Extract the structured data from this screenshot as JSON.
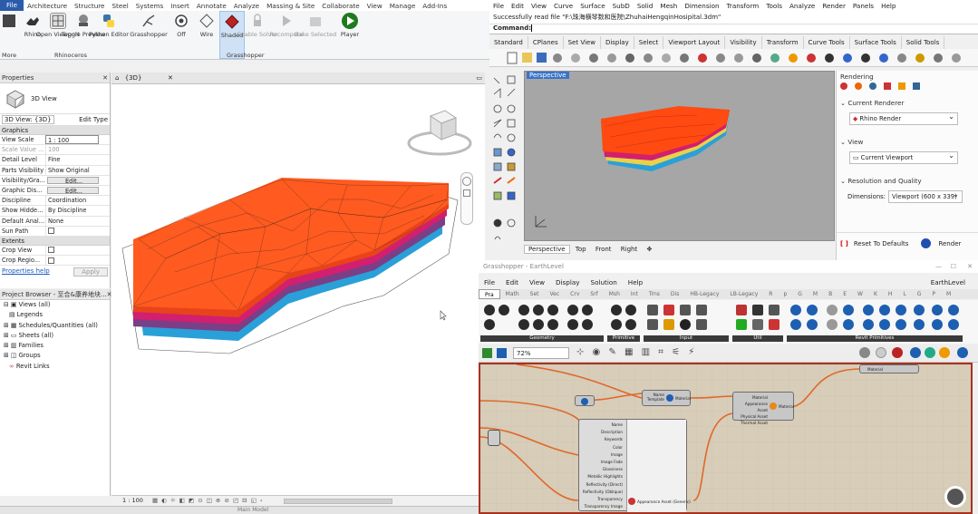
{
  "revit": {
    "menu": [
      "File",
      "Architecture",
      "Structure",
      "Steel",
      "Systems",
      "Insert",
      "Annotate",
      "Analyze",
      "Massing & Site",
      "Collaborate",
      "View",
      "Manage",
      "Add-Ins"
    ],
    "ribbon_buttons": [
      "Rhino",
      "Open Viewport",
      "Toggle Preview",
      "Python Editor",
      "Grasshopper",
      "Off",
      "Wire",
      "Shaded",
      "Enable Solver",
      "Recompute",
      "Bake Selected",
      "Player"
    ],
    "ribbon_groups": {
      "more": "More",
      "rhinoceros": "Rhinoceros",
      "grasshopper": "Grasshopper"
    },
    "properties": {
      "title": "Properties",
      "type_label": "3D View",
      "view_selector": "3D View: {3D}",
      "edit_type": "Edit Type",
      "section_graphics": "Graphics",
      "rows": [
        {
          "k": "View Scale",
          "v": "1 : 100"
        },
        {
          "k": "Scale Value ...",
          "v": "100"
        },
        {
          "k": "Detail Level",
          "v": "Fine"
        },
        {
          "k": "Parts Visibility",
          "v": "Show Original"
        },
        {
          "k": "Visibility/Gra...",
          "v": "Edit..."
        },
        {
          "k": "Graphic Dis...",
          "v": "Edit..."
        },
        {
          "k": "Discipline",
          "v": "Coordination"
        },
        {
          "k": "Show Hidde...",
          "v": "By Discipline"
        },
        {
          "k": "Default Anal...",
          "v": "None"
        },
        {
          "k": "Sun Path",
          "v": ""
        }
      ],
      "section_extents": "Extents",
      "rows2": [
        {
          "k": "Crop View",
          "v": ""
        },
        {
          "k": "Crop Regio...",
          "v": ""
        }
      ],
      "help": "Properties help",
      "apply": "Apply"
    },
    "browser": {
      "title": "Project Browser - 至合&康养地块...",
      "items": [
        "Views (all)",
        "Legends",
        "Schedules/Quantities (all)",
        "Sheets (all)",
        "Families",
        "Groups",
        "Revit Links"
      ]
    },
    "view_tab": "{3D}",
    "view_scale": "1 : 100",
    "bottom_status": "Main Model"
  },
  "rhino": {
    "menu": [
      "File",
      "Edit",
      "View",
      "Curve",
      "Surface",
      "SubD",
      "Solid",
      "Mesh",
      "Dimension",
      "Transform",
      "Tools",
      "Analyze",
      "Render",
      "Panels",
      "Help"
    ],
    "cmd_history": "Successfully read file \"F:\\珠海横琴数和医院\\ZhuhaiHengqinHosipital.3dm\"",
    "cmd_label": "Command:",
    "tabs": [
      "Standard",
      "CPlanes",
      "Set View",
      "Display",
      "Select",
      "Viewport Layout",
      "Visibility",
      "Transform",
      "Curve Tools",
      "Surface Tools",
      "Solid Tools"
    ],
    "viewport_label": "Perspective",
    "viewport_tabs": [
      "Perspective",
      "Top",
      "Front",
      "Right"
    ],
    "rendering": {
      "title": "Rendering",
      "current_renderer": "Current Renderer",
      "renderer": "Rhino Render",
      "view": "View",
      "view_value": "Current Viewport",
      "resolution": "Resolution and Quality",
      "dimensions_label": "Dimensions:",
      "dimensions": "Viewport (600 x 339)",
      "reset": "Reset To Defaults",
      "render": "Render"
    }
  },
  "grasshopper": {
    "title": "Grasshopper - EarthLevel",
    "doc_name": "EarthLevel",
    "menu": [
      "File",
      "Edit",
      "View",
      "Display",
      "Solution",
      "Help"
    ],
    "categories": [
      "Pra",
      "Math",
      "Set",
      "Vec",
      "Crv",
      "Srf",
      "Msh",
      "Int",
      "Trns",
      "Dis",
      "HB-Legacy",
      "LB-Legacy",
      "R",
      "p",
      "G",
      "M",
      "B",
      "E",
      "W",
      "K",
      "H",
      "L",
      "G",
      "P",
      "M"
    ],
    "groups": [
      "Geometry",
      "Primitive",
      "Input",
      "Util",
      "Revit Primitives"
    ],
    "zoom": "72%",
    "node_material_in": [
      "Name",
      "Template"
    ],
    "node_material_out": "Material",
    "node_material2_in": [
      "Material",
      "Appearance Asset",
      "Physical Asset",
      "Thermal Asset"
    ],
    "node_material2_out": "Material",
    "node_material3": "Material",
    "node_asset_in": [
      "Name",
      "Description",
      "Keywords",
      "Color",
      "Image",
      "Image Fade",
      "Glossiness",
      "Metallic Highlights",
      "Reflectivity (Direct)",
      "Reflectivity (Oblique)",
      "Transparency",
      "Transparency Image"
    ],
    "node_asset_out": "Appearance Asset (Generic)"
  }
}
